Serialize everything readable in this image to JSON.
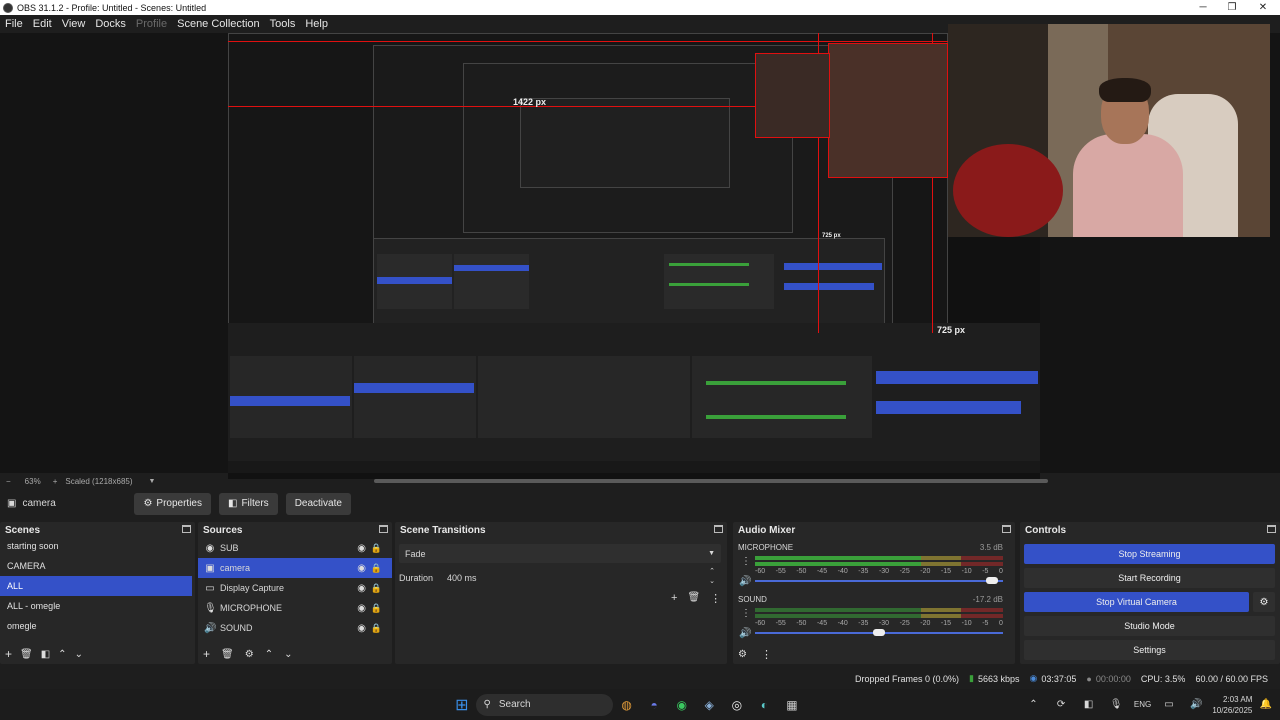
{
  "window": {
    "title": "OBS 31.1.2 - Profile: Untitled - Scenes: Untitled",
    "minimize": "─",
    "maximize": "❐",
    "close": "✕"
  },
  "menu": [
    {
      "label": "File",
      "enabled": true
    },
    {
      "label": "Edit",
      "enabled": true
    },
    {
      "label": "View",
      "enabled": true
    },
    {
      "label": "Docks",
      "enabled": true
    },
    {
      "label": "Profile",
      "enabled": false
    },
    {
      "label": "Scene Collection",
      "enabled": true
    },
    {
      "label": "Tools",
      "enabled": true
    },
    {
      "label": "Help",
      "enabled": true
    }
  ],
  "preview": {
    "measure_width": "1422 px",
    "measure_height_small": "725 px",
    "measure_height": "725 px"
  },
  "zoom": {
    "minus": "−",
    "level": "63%",
    "plus": "+",
    "scale_mode": "Scaled (1218x685)"
  },
  "source_toolbar": {
    "source_name": "camera",
    "properties": "Properties",
    "filters": "Filters",
    "deactivate": "Deactivate"
  },
  "scenes": {
    "title": "Scenes",
    "items": [
      "starting soon",
      "CAMERA",
      "ALL",
      "ALL - omegle",
      "omegle"
    ],
    "selected_index": 2
  },
  "sources": {
    "title": "Sources",
    "items": [
      {
        "name": "SUB",
        "icon": "◉"
      },
      {
        "name": "camera",
        "icon": "▣"
      },
      {
        "name": "Display Capture",
        "icon": "▭"
      },
      {
        "name": "MICROPHONE",
        "icon": "🎙"
      },
      {
        "name": "SOUND",
        "icon": "🔊"
      }
    ],
    "selected_index": 1
  },
  "transitions": {
    "title": "Scene Transitions",
    "transition": "Fade",
    "duration_label": "Duration",
    "duration_value": "400 ms"
  },
  "audio": {
    "title": "Audio Mixer",
    "channels": [
      {
        "name": "MICROPHONE",
        "db": "3.5 dB",
        "volume": 0.98
      },
      {
        "name": "SOUND",
        "db": "-17.2 dB",
        "volume": 0.5
      }
    ],
    "scale": [
      "-60",
      "-55",
      "-50",
      "-45",
      "-40",
      "-35",
      "-30",
      "-25",
      "-20",
      "-15",
      "-10",
      "-5",
      "0"
    ]
  },
  "controls": {
    "title": "Controls",
    "stop_streaming": "Stop Streaming",
    "start_recording": "Start Recording",
    "stop_virtual_camera": "Stop Virtual Camera",
    "studio_mode": "Studio Mode",
    "settings": "Settings"
  },
  "status": {
    "dropped_frames": "Dropped Frames 0 (0.0%)",
    "bitrate": "5663 kbps",
    "stream_time": "03:37:05",
    "record_time": "00:00:00",
    "cpu": "CPU: 3.5%",
    "fps": "60.00 / 60.00 FPS"
  },
  "taskbar": {
    "search_placeholder": "Search",
    "language": "ENG",
    "time": "2:03 AM",
    "date": "10/26/2025"
  },
  "colors": {
    "accent": "#3451c8",
    "meter_green": "#3aa03a",
    "meter_yellow": "#c8b43a",
    "meter_red": "#b02a2a",
    "guide_red": "#e01010"
  }
}
